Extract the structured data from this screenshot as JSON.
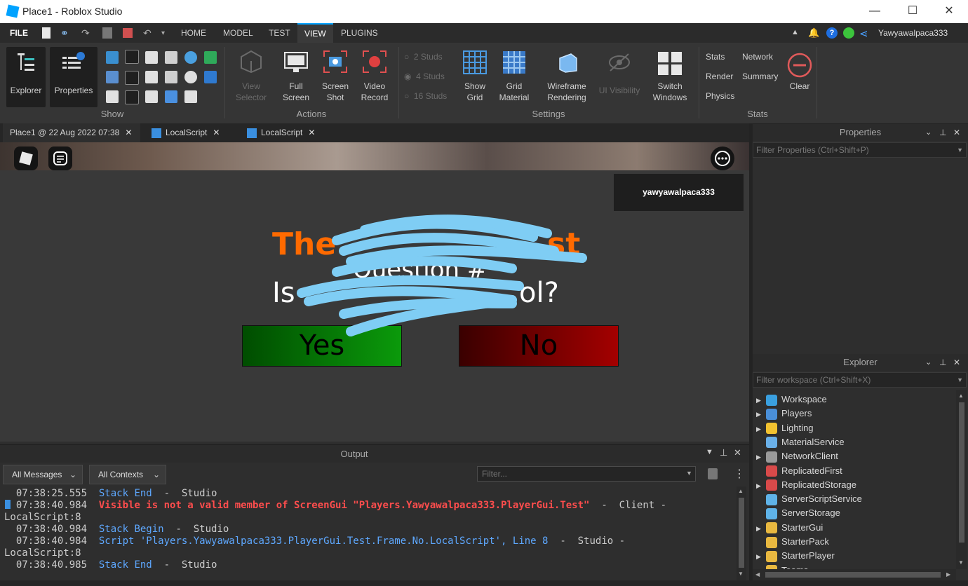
{
  "window": {
    "title": "Place1 - Roblox Studio",
    "minimize": "—",
    "maximize": "☐",
    "close": "✕"
  },
  "menubar": {
    "file": "FILE",
    "tabs": [
      "HOME",
      "MODEL",
      "TEST",
      "VIEW",
      "PLUGINS"
    ],
    "active_tab": "VIEW",
    "username": "Yawyawalpaca333"
  },
  "ribbon": {
    "show": {
      "explorer": "Explorer",
      "properties": "Properties",
      "group": "Show"
    },
    "actions": {
      "view_selector_1": "View",
      "view_selector_2": "Selector",
      "full_screen_1": "Full",
      "full_screen_2": "Screen",
      "screen_shot_1": "Screen",
      "screen_shot_2": "Shot",
      "video_record_1": "Video",
      "video_record_2": "Record",
      "group": "Actions"
    },
    "settings": {
      "studs_2": "2 Studs",
      "studs_4": "4 Studs",
      "studs_16": "16 Studs",
      "show_grid_1": "Show",
      "show_grid_2": "Grid",
      "grid_material_1": "Grid",
      "grid_material_2": "Material",
      "wireframe_1": "Wireframe",
      "wireframe_2": "Rendering",
      "ui_visibility": "UI Visibility",
      "switch_windows_1": "Switch",
      "switch_windows_2": "Windows",
      "group": "Settings"
    },
    "stats": {
      "stats": "Stats",
      "network": "Network",
      "render": "Render",
      "summary": "Summary",
      "physics": "Physics",
      "clear": "Clear",
      "group": "Stats"
    }
  },
  "doc_tabs": [
    "Place1 @ 22 Aug 2022 07:38",
    "LocalScript",
    "LocalScript"
  ],
  "viewport": {
    "player_name": "yawyawalpaca333",
    "heading_start": "The",
    "heading_end": "st",
    "question_number": "Question #",
    "question_start": "Is",
    "question_end": "ol?",
    "yes": "Yes",
    "no": "No"
  },
  "output": {
    "title": "Output",
    "messages_filter": "All Messages",
    "contexts_filter": "All Contexts",
    "filter_placeholder": "Filter...",
    "lines": [
      {
        "ts": "07:38:25.555",
        "text": "Stack End",
        "suffix": "  -  Studio"
      },
      {
        "ts": "07:38:40.984",
        "text": "Visible is not a valid member of ScreenGui \"Players.Yawyawalpaca333.PlayerGui.Test\"",
        "suffix": "  -  Client -"
      },
      {
        "ts": "",
        "text": "LocalScript:8",
        "suffix": ""
      },
      {
        "ts": "07:38:40.984",
        "text": "Stack Begin",
        "suffix": "  -  Studio"
      },
      {
        "ts": "07:38:40.984",
        "text": "Script 'Players.Yawyawalpaca333.PlayerGui.Test.Frame.No.LocalScript', Line 8",
        "suffix": "  -  Studio -"
      },
      {
        "ts": "",
        "text": "LocalScript:8",
        "suffix": ""
      },
      {
        "ts": "07:38:40.985",
        "text": "Stack End",
        "suffix": "  -  Studio"
      }
    ]
  },
  "properties": {
    "title": "Properties",
    "filter_placeholder": "Filter Properties (Ctrl+Shift+P)"
  },
  "explorer": {
    "title": "Explorer",
    "filter_placeholder": "Filter workspace (Ctrl+Shift+X)",
    "items": [
      {
        "label": "Workspace",
        "expandable": true,
        "color": "#3aa0e0"
      },
      {
        "label": "Players",
        "expandable": true,
        "color": "#4a8fd8"
      },
      {
        "label": "Lighting",
        "expandable": true,
        "color": "#f2c230"
      },
      {
        "label": "MaterialService",
        "expandable": false,
        "color": "#6ab0e8"
      },
      {
        "label": "NetworkClient",
        "expandable": true,
        "color": "#9a9a9a"
      },
      {
        "label": "ReplicatedFirst",
        "expandable": false,
        "color": "#d94a4a"
      },
      {
        "label": "ReplicatedStorage",
        "expandable": true,
        "color": "#d94a4a"
      },
      {
        "label": "ServerScriptService",
        "expandable": false,
        "color": "#5fb3e8"
      },
      {
        "label": "ServerStorage",
        "expandable": false,
        "color": "#5fb3e8"
      },
      {
        "label": "StarterGui",
        "expandable": true,
        "color": "#e8b840"
      },
      {
        "label": "StarterPack",
        "expandable": false,
        "color": "#e8b840"
      },
      {
        "label": "StarterPlayer",
        "expandable": true,
        "color": "#e8b840"
      },
      {
        "label": "Teams",
        "expandable": false,
        "color": "#e8b840"
      }
    ]
  }
}
